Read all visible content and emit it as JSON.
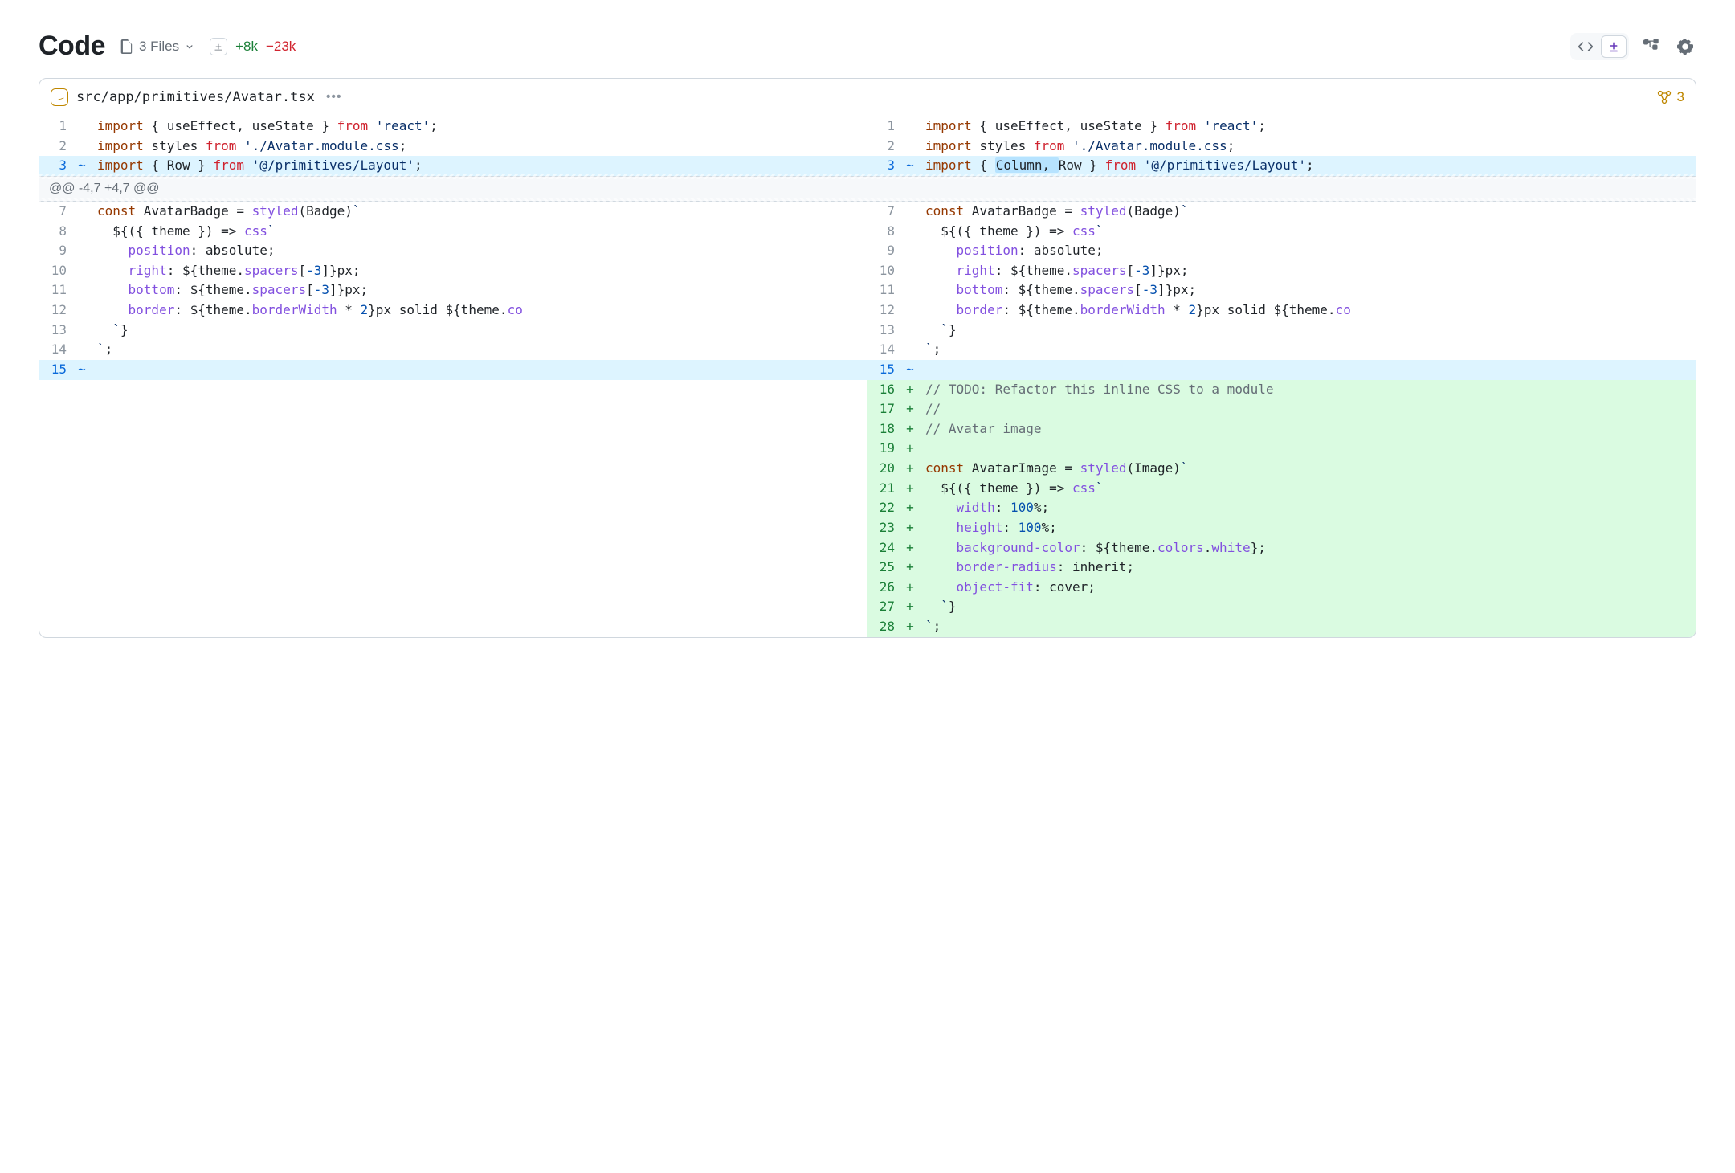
{
  "header": {
    "title": "Code",
    "files_label": "3 Files",
    "additions": "+8k",
    "deletions": "−23k"
  },
  "file": {
    "path": "src/app/primitives/Avatar.tsx",
    "comment_count": "3"
  },
  "hunk": {
    "label": "@@ -4,7 +4,7 @@"
  },
  "left": {
    "lines": [
      {
        "n": "1",
        "m": "",
        "row": "",
        "seg": [
          [
            "t-d",
            "import"
          ],
          [
            "t-p",
            " { useEffect, useState } "
          ],
          [
            "t-k",
            "from"
          ],
          [
            "t-p",
            " "
          ],
          [
            "t-s",
            "'react'"
          ],
          [
            "t-p",
            ";"
          ]
        ]
      },
      {
        "n": "2",
        "m": "",
        "row": "",
        "seg": [
          [
            "t-d",
            "import"
          ],
          [
            "t-p",
            " styles "
          ],
          [
            "t-k",
            "from"
          ],
          [
            "t-p",
            " "
          ],
          [
            "t-s",
            "'./Avatar.module.css"
          ],
          [
            "t-p",
            ";"
          ]
        ]
      },
      {
        "n": "3",
        "m": "~",
        "row": "mod",
        "seg": [
          [
            "t-d",
            "import"
          ],
          [
            "t-p",
            " { Row } "
          ],
          [
            "t-k",
            "from"
          ],
          [
            "t-p",
            " "
          ],
          [
            "t-s",
            "'@/primitives/Layout'"
          ],
          [
            "t-p",
            ";"
          ]
        ]
      }
    ],
    "body": [
      {
        "n": "7",
        "m": "",
        "row": "",
        "seg": [
          [
            "t-d",
            "const"
          ],
          [
            "t-p",
            " AvatarBadge = "
          ],
          [
            "t-f",
            "styled"
          ],
          [
            "t-p",
            "(Badge)"
          ],
          [
            "t-s",
            "`"
          ]
        ]
      },
      {
        "n": "8",
        "m": "",
        "row": "",
        "seg": [
          [
            "t-p",
            "  ${({ theme }) => "
          ],
          [
            "t-f",
            "css"
          ],
          [
            "t-s",
            "`"
          ]
        ]
      },
      {
        "n": "9",
        "m": "",
        "row": "",
        "seg": [
          [
            "t-p",
            "    "
          ],
          [
            "t-f",
            "position"
          ],
          [
            "t-p",
            ": absolute;"
          ]
        ]
      },
      {
        "n": "10",
        "m": "",
        "row": "",
        "seg": [
          [
            "t-p",
            "    "
          ],
          [
            "t-f",
            "right"
          ],
          [
            "t-p",
            ": ${theme."
          ],
          [
            "t-f",
            "spacers"
          ],
          [
            "t-p",
            "["
          ],
          [
            "t-n",
            "-3"
          ],
          [
            "t-p",
            "]}px;"
          ]
        ]
      },
      {
        "n": "11",
        "m": "",
        "row": "",
        "seg": [
          [
            "t-p",
            "    "
          ],
          [
            "t-f",
            "bottom"
          ],
          [
            "t-p",
            ": ${theme."
          ],
          [
            "t-f",
            "spacers"
          ],
          [
            "t-p",
            "["
          ],
          [
            "t-n",
            "-3"
          ],
          [
            "t-p",
            "]}px;"
          ]
        ]
      },
      {
        "n": "12",
        "m": "",
        "row": "",
        "seg": [
          [
            "t-p",
            "    "
          ],
          [
            "t-f",
            "border"
          ],
          [
            "t-p",
            ": ${theme."
          ],
          [
            "t-f",
            "borderWidth"
          ],
          [
            "t-p",
            " * "
          ],
          [
            "t-n",
            "2"
          ],
          [
            "t-p",
            "}px solid ${theme."
          ],
          [
            "t-f",
            "co"
          ]
        ]
      },
      {
        "n": "13",
        "m": "",
        "row": "",
        "seg": [
          [
            "t-p",
            "  "
          ],
          [
            "t-s",
            "`"
          ],
          [
            "t-p",
            "}"
          ]
        ]
      },
      {
        "n": "14",
        "m": "",
        "row": "",
        "seg": [
          [
            "t-s",
            "`"
          ],
          [
            "t-p",
            ";"
          ]
        ]
      },
      {
        "n": "15",
        "m": "~",
        "row": "mod",
        "seg": [
          [
            "t-p",
            ""
          ]
        ]
      }
    ]
  },
  "right": {
    "lines": [
      {
        "n": "1",
        "m": "",
        "row": "",
        "seg": [
          [
            "t-d",
            "import"
          ],
          [
            "t-p",
            " { useEffect, useState } "
          ],
          [
            "t-k",
            "from"
          ],
          [
            "t-p",
            " "
          ],
          [
            "t-s",
            "'react'"
          ],
          [
            "t-p",
            ";"
          ]
        ]
      },
      {
        "n": "2",
        "m": "",
        "row": "",
        "seg": [
          [
            "t-d",
            "import"
          ],
          [
            "t-p",
            " styles "
          ],
          [
            "t-k",
            "from"
          ],
          [
            "t-p",
            " "
          ],
          [
            "t-s",
            "'./Avatar.module.css"
          ],
          [
            "t-p",
            ";"
          ]
        ]
      },
      {
        "n": "3",
        "m": "~",
        "row": "mod",
        "seg": [
          [
            "t-d",
            "import"
          ],
          [
            "t-p",
            " { "
          ],
          [
            "hi",
            "Column, "
          ],
          [
            "t-p",
            "Row } "
          ],
          [
            "t-k",
            "from"
          ],
          [
            "t-p",
            " "
          ],
          [
            "t-s",
            "'@/primitives/Layout'"
          ],
          [
            "t-p",
            ";"
          ]
        ]
      }
    ],
    "body": [
      {
        "n": "7",
        "m": "",
        "row": "",
        "seg": [
          [
            "t-d",
            "const"
          ],
          [
            "t-p",
            " AvatarBadge = "
          ],
          [
            "t-f",
            "styled"
          ],
          [
            "t-p",
            "(Badge)"
          ],
          [
            "t-s",
            "`"
          ]
        ]
      },
      {
        "n": "8",
        "m": "",
        "row": "",
        "seg": [
          [
            "t-p",
            "  ${({ theme }) => "
          ],
          [
            "t-f",
            "css"
          ],
          [
            "t-s",
            "`"
          ]
        ]
      },
      {
        "n": "9",
        "m": "",
        "row": "",
        "seg": [
          [
            "t-p",
            "    "
          ],
          [
            "t-f",
            "position"
          ],
          [
            "t-p",
            ": absolute;"
          ]
        ]
      },
      {
        "n": "10",
        "m": "",
        "row": "",
        "seg": [
          [
            "t-p",
            "    "
          ],
          [
            "t-f",
            "right"
          ],
          [
            "t-p",
            ": ${theme."
          ],
          [
            "t-f",
            "spacers"
          ],
          [
            "t-p",
            "["
          ],
          [
            "t-n",
            "-3"
          ],
          [
            "t-p",
            "]}px;"
          ]
        ]
      },
      {
        "n": "11",
        "m": "",
        "row": "",
        "seg": [
          [
            "t-p",
            "    "
          ],
          [
            "t-f",
            "bottom"
          ],
          [
            "t-p",
            ": ${theme."
          ],
          [
            "t-f",
            "spacers"
          ],
          [
            "t-p",
            "["
          ],
          [
            "t-n",
            "-3"
          ],
          [
            "t-p",
            "]}px;"
          ]
        ]
      },
      {
        "n": "12",
        "m": "",
        "row": "",
        "seg": [
          [
            "t-p",
            "    "
          ],
          [
            "t-f",
            "border"
          ],
          [
            "t-p",
            ": ${theme."
          ],
          [
            "t-f",
            "borderWidth"
          ],
          [
            "t-p",
            " * "
          ],
          [
            "t-n",
            "2"
          ],
          [
            "t-p",
            "}px solid ${theme."
          ],
          [
            "t-f",
            "co"
          ]
        ]
      },
      {
        "n": "13",
        "m": "",
        "row": "",
        "seg": [
          [
            "t-p",
            "  "
          ],
          [
            "t-s",
            "`"
          ],
          [
            "t-p",
            "}"
          ]
        ]
      },
      {
        "n": "14",
        "m": "",
        "row": "",
        "seg": [
          [
            "t-s",
            "`"
          ],
          [
            "t-p",
            ";"
          ]
        ]
      },
      {
        "n": "15",
        "m": "~",
        "row": "mod",
        "seg": [
          [
            "t-p",
            ""
          ]
        ]
      },
      {
        "n": "16",
        "m": "+",
        "row": "add-row",
        "seg": [
          [
            "t-c",
            "// TODO: Refactor this inline CSS to a module"
          ]
        ]
      },
      {
        "n": "17",
        "m": "+",
        "row": "add-row",
        "seg": [
          [
            "t-c",
            "//"
          ]
        ]
      },
      {
        "n": "18",
        "m": "+",
        "row": "add-row",
        "seg": [
          [
            "t-c",
            "// Avatar image"
          ]
        ]
      },
      {
        "n": "19",
        "m": "+",
        "row": "add-row",
        "seg": [
          [
            "t-p",
            ""
          ]
        ]
      },
      {
        "n": "20",
        "m": "+",
        "row": "add-row",
        "seg": [
          [
            "t-d",
            "const"
          ],
          [
            "t-p",
            " AvatarImage = "
          ],
          [
            "t-f",
            "styled"
          ],
          [
            "t-p",
            "(Image)"
          ],
          [
            "t-s",
            "`"
          ]
        ]
      },
      {
        "n": "21",
        "m": "+",
        "row": "add-row",
        "seg": [
          [
            "t-p",
            "  ${({ theme }) => "
          ],
          [
            "t-f",
            "css"
          ],
          [
            "t-s",
            "`"
          ]
        ]
      },
      {
        "n": "22",
        "m": "+",
        "row": "add-row",
        "seg": [
          [
            "t-p",
            "    "
          ],
          [
            "t-f",
            "width"
          ],
          [
            "t-p",
            ": "
          ],
          [
            "t-n",
            "100"
          ],
          [
            "t-p",
            "%;"
          ]
        ]
      },
      {
        "n": "23",
        "m": "+",
        "row": "add-row",
        "seg": [
          [
            "t-p",
            "    "
          ],
          [
            "t-f",
            "height"
          ],
          [
            "t-p",
            ": "
          ],
          [
            "t-n",
            "100"
          ],
          [
            "t-p",
            "%;"
          ]
        ]
      },
      {
        "n": "24",
        "m": "+",
        "row": "add-row",
        "seg": [
          [
            "t-p",
            "    "
          ],
          [
            "t-f",
            "background-color"
          ],
          [
            "t-p",
            ": ${theme."
          ],
          [
            "t-f",
            "colors"
          ],
          [
            "t-p",
            "."
          ],
          [
            "t-f",
            "white"
          ],
          [
            "t-p",
            "};"
          ]
        ]
      },
      {
        "n": "25",
        "m": "+",
        "row": "add-row",
        "seg": [
          [
            "t-p",
            "    "
          ],
          [
            "t-f",
            "border-radius"
          ],
          [
            "t-p",
            ": inherit;"
          ]
        ]
      },
      {
        "n": "26",
        "m": "+",
        "row": "add-row",
        "seg": [
          [
            "t-p",
            "    "
          ],
          [
            "t-f",
            "object-fit"
          ],
          [
            "t-p",
            ": cover;"
          ]
        ]
      },
      {
        "n": "27",
        "m": "+",
        "row": "add-row",
        "seg": [
          [
            "t-p",
            "  "
          ],
          [
            "t-s",
            "`"
          ],
          [
            "t-p",
            "}"
          ]
        ]
      },
      {
        "n": "28",
        "m": "+",
        "row": "add-row",
        "seg": [
          [
            "t-s",
            "`"
          ],
          [
            "t-p",
            ";"
          ]
        ]
      }
    ]
  }
}
